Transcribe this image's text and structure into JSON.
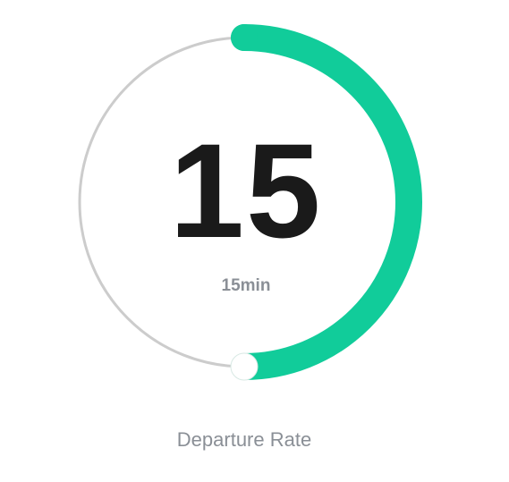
{
  "gauge": {
    "value": "15",
    "subtitle": "15min",
    "caption": "Departure Rate",
    "progress_fraction": 0.5,
    "track_color": "#cccccc",
    "progress_color": "#11cc9a",
    "handle_color": "#ffffff"
  }
}
